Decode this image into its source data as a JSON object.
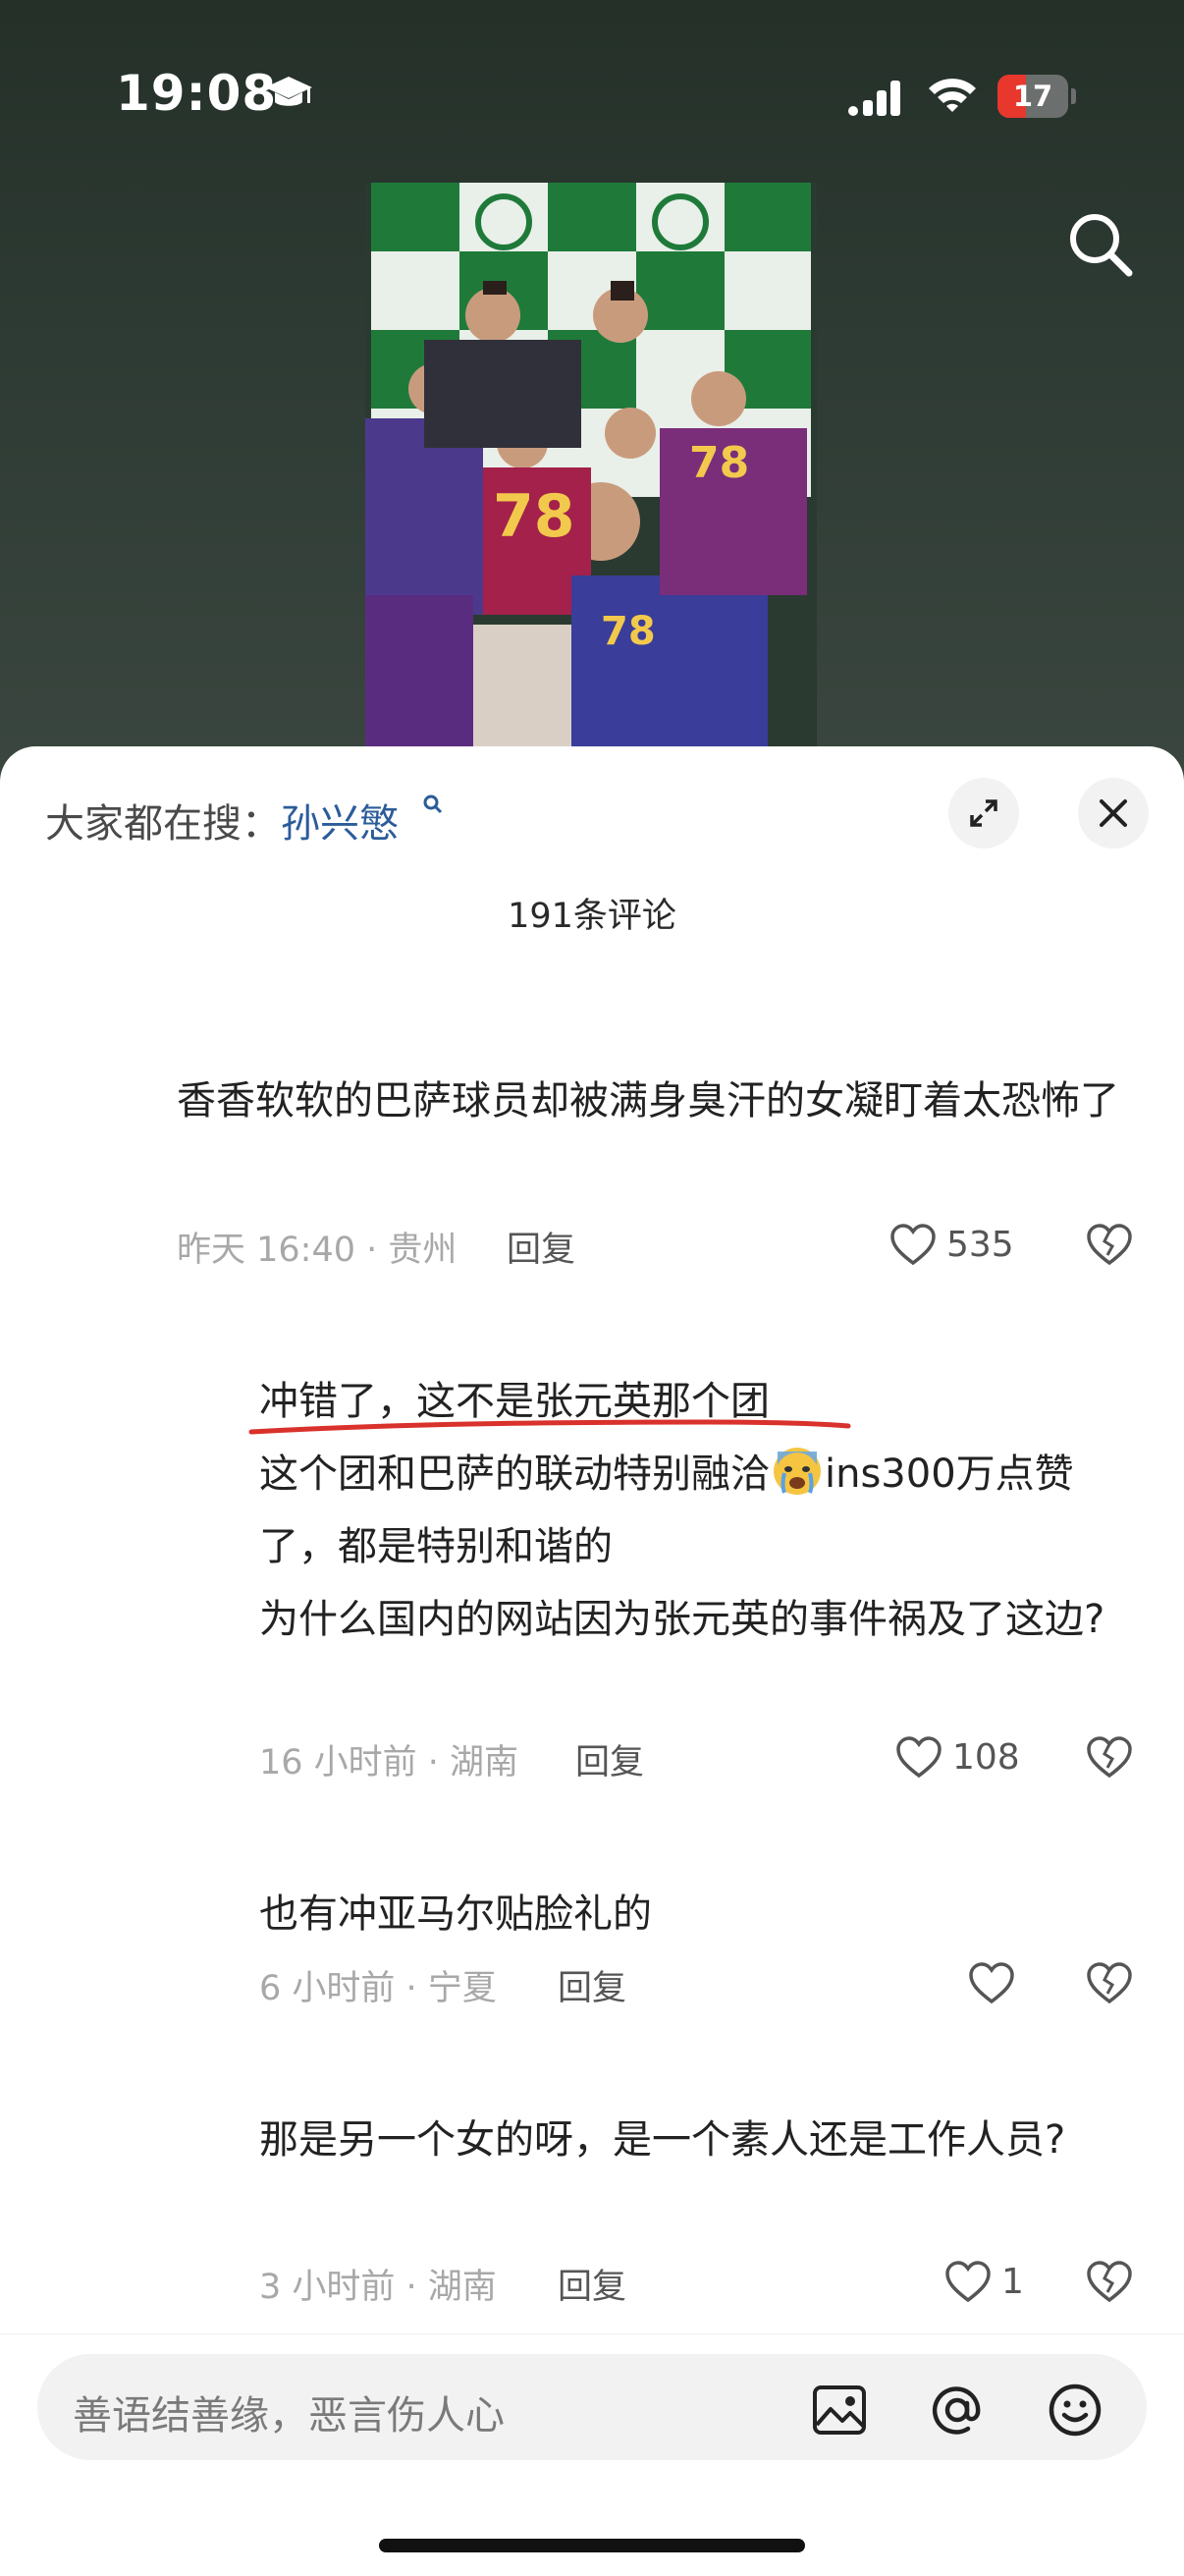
{
  "status_bar": {
    "time": "19:08",
    "battery": "17",
    "battery_level": 0.17
  },
  "video": {
    "icons": [
      "search-icon"
    ]
  },
  "sheet": {
    "trending_prefix": "大家都在搜：",
    "trending_term": "孙兴慜",
    "comment_count": "191条评论",
    "comments": [
      {
        "text": "香香软软的巴萨球员却被满身臭汗的女凝盯着太恐怖了",
        "meta": "昨天 16:40 · 贵州",
        "reply": "回复",
        "likes": "535"
      },
      {
        "line1": "冲错了，这不是张元英那个团",
        "line2_a": "这个团和巴萨的联动特别融洽",
        "line2_b": "ins300万点赞了，都是特别和谐的",
        "line3": "为什么国内的网站因为张元英的事件祸及了这边?",
        "meta": "16 小时前 · 湖南",
        "reply": "回复",
        "likes": "108"
      },
      {
        "text": "也有冲亚马尔贴脸礼的",
        "meta": "6 小时前 · 宁夏",
        "reply": "回复",
        "likes": ""
      },
      {
        "text": "那是另一个女的呀，是一个素人还是工作人员?",
        "meta": "3 小时前 · 湖南",
        "reply": "回复",
        "likes": "1"
      }
    ]
  },
  "input_bar": {
    "placeholder": "善语结善缘，恶言伤人心",
    "icons": [
      "image-icon",
      "at-icon",
      "emoji-icon"
    ]
  },
  "colors": {
    "link": "#2b5c9a",
    "underline": "#d9312b",
    "battery_low": "#e8372d"
  }
}
